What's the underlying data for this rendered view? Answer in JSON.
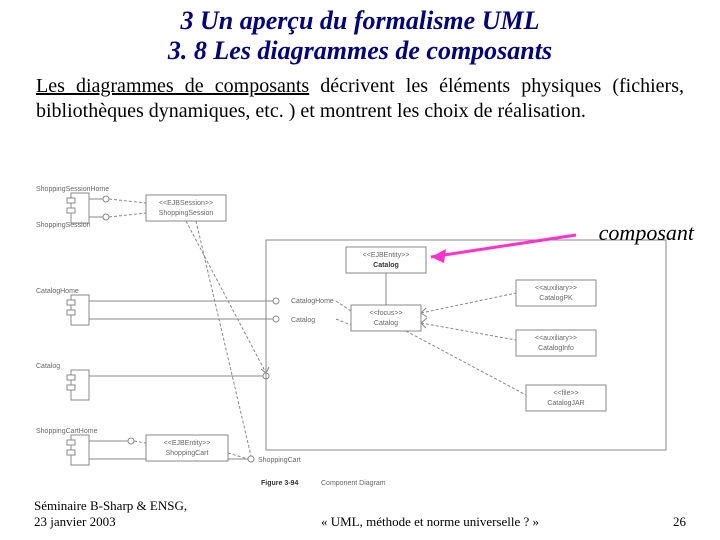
{
  "title": {
    "line1": "3 Un aperçu du formalisme UML",
    "line2": "3. 8 Les diagrammes de composants"
  },
  "body": {
    "lead": "Les diagrammes de composants",
    "rest": " décrivent les éléments physiques (fichiers, bibliothèques dynamiques, etc. ) et montrent les choix de réalisation."
  },
  "callout": "composant",
  "diagram": {
    "nodes": {
      "ss_home": "ShoppingSessionHome",
      "ss": "ShoppingSession",
      "ejb_session": "<<EJBSession>>",
      "ejb_session_name": "ShoppingSession",
      "catalog_home": "CatalogHome",
      "catalog_iface": "Catalog",
      "ejb_entity": "<<EJBEntity>>",
      "ejb_entity_name": "Catalog",
      "focus": "<<focus>>",
      "focus_name": "Catalog",
      "aux1": "<<auxiliary>>",
      "aux1_name": "CatalogPK",
      "aux2": "<<auxiliary>>",
      "aux2_name": "CatalogInfo",
      "file": "<<file>>",
      "file_name": "CatalogJAR",
      "catalog2": "Catalog",
      "sc_home": "ShoppingCartHome",
      "sc": "ShoppingCart",
      "ejb_entity2": "<<EJBEntity>>",
      "ejb_entity2_name": "ShoppingCart"
    },
    "caption_a": "Figure 3-94",
    "caption_b": "Component Diagram"
  },
  "footer": {
    "left1": "Séminaire B-Sharp & ENSG,",
    "left2": "23 janvier 2003",
    "center": " « UML, méthode et norme universelle ? »",
    "right": "26"
  }
}
